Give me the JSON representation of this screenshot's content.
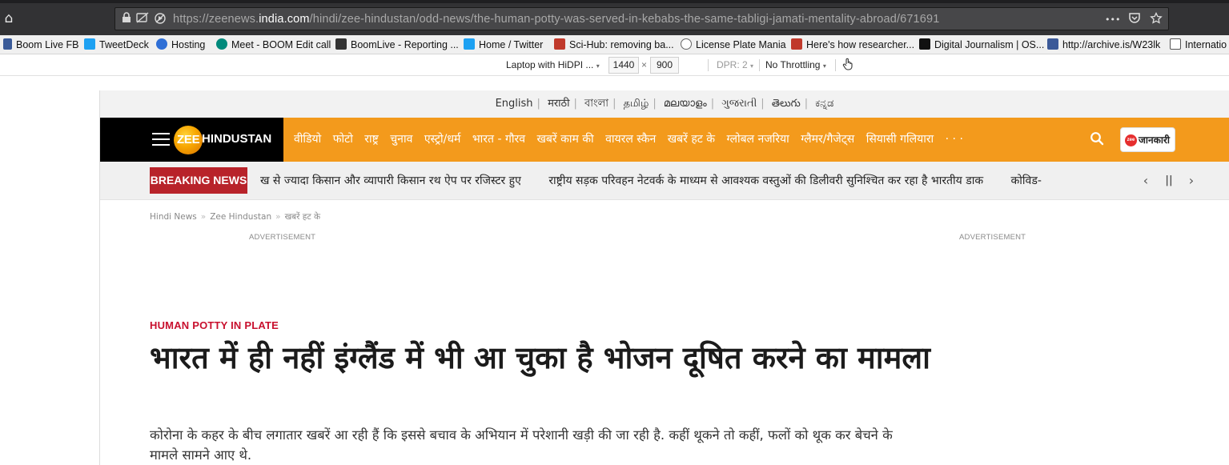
{
  "browser": {
    "url_prefix": "https://zeenews.",
    "url_domain": "india.com",
    "url_path": "/hindi/zee-hindustan/odd-news/the-human-potty-was-served-in-kebabs-the-same-tabligi-jamati-mentality-abroad/671691",
    "more_glyph": "•••",
    "bookmarks": [
      {
        "label": "Boom Live FB",
        "icon": "boom-favicon",
        "color": "#3a5a98"
      },
      {
        "label": "TweetDeck",
        "icon": "tweetdeck-icon",
        "color": "#1da1f2"
      },
      {
        "label": "Hosting",
        "icon": "hosting-icon",
        "color": "#2f6fd6"
      },
      {
        "label": "Meet - BOOM Edit call",
        "icon": "meet-icon",
        "color": "#00897b"
      },
      {
        "label": "BoomLive - Reporting ...",
        "icon": "boomlive-icon",
        "color": "#333333"
      },
      {
        "label": "Home / Twitter",
        "icon": "twitter-icon",
        "color": "#1da1f2"
      },
      {
        "label": "Sci-Hub: removing ba...",
        "icon": "scihub-icon",
        "color": "#c0392b"
      },
      {
        "label": "License Plate Mania",
        "icon": "globe-icon",
        "color": "#666666"
      },
      {
        "label": "Here's how researcher...",
        "icon": "nl-icon",
        "color": "#c0392b"
      },
      {
        "label": "Digital Journalism | OS...",
        "icon": "dj-icon",
        "color": "#111111"
      },
      {
        "label": "http://archive.is/W23lk",
        "icon": "facebook-icon",
        "color": "#3b5998"
      },
      {
        "label": "Internatio",
        "icon": "folder-icon",
        "color": "#555555"
      }
    ]
  },
  "devtools": {
    "device": "Laptop with HiDPI ...",
    "width": "1440",
    "times": "×",
    "height": "900",
    "dpr": "DPR: 2",
    "throttle": "No Throttling"
  },
  "site": {
    "languages": [
      "English",
      "मराठी",
      "বাংলা",
      "தமிழ்",
      "മലയാളം",
      "ગુજરાતી",
      "తెలుగు",
      "ಕನ್ನಡ"
    ],
    "logo_zee": "ZEE",
    "logo_rest": "HINDUSTAN",
    "nav": [
      "वीडियो",
      "फोटो",
      "राष्ट्र",
      "चुनाव",
      "एस्ट्रो/धर्म",
      "भारत - गौरव",
      "खबरें काम की",
      "वायरल स्कैन",
      "खबरें हट के",
      "ग्लोबल नजरिया",
      "ग्लैमर/गैजेट्स",
      "सियासी गलियारा"
    ],
    "nav_more": "· · ·",
    "jankari_badge": "zee",
    "jankari_label": "जानकारी",
    "breaking_label": "BREAKING NEWS",
    "ticker": [
      "ख से ज्यादा किसान और व्यापारी किसान रथ ऐप पर रजिस्टर हुए",
      "राष्ट्रीय सड़क परिवहन नेटवर्क के माध्यम से आवश्यक वस्तुओं की डिलीवरी सुनिश्चित कर रहा है भारतीय डाक",
      "कोविड-"
    ],
    "breadcrumb": [
      "Hindi News",
      "Zee Hindustan",
      "खबरें हट के"
    ],
    "breadcrumb_sep": "»",
    "advertisement": "ADVERTISEMENT",
    "kicker": "HUMAN POTTY IN PLATE",
    "headline": "भारत में ही नहीं इंग्लैंड में भी आ चुका है भोजन दूषित करने का मामला",
    "summary": "कोरोना के कहर के बीच लगातार खबरें आ रही हैं कि इससे बचाव के अभियान में परेशानी खड़ी की जा रही है. कहीं थूकने तो कहीं, फलों को थूक कर बेचने के मामले सामने आए थे."
  }
}
